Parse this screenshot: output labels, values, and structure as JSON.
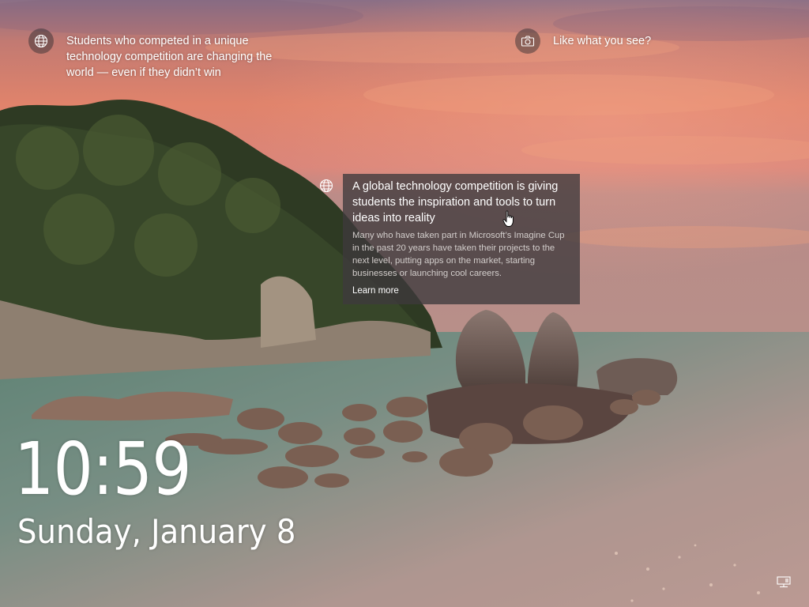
{
  "lockscreen": {
    "time": "10:59",
    "date": "Sunday, January 8"
  },
  "spotlight": {
    "headline": "Students who competed in a unique technology competition are changing the world — even if they didn’t win",
    "like_prompt": "Like what you see?"
  },
  "card": {
    "title": "A global technology competition is giving students the inspiration and tools to turn ideas into reality",
    "body": "Many who have taken part in Microsoft’s Imagine Cup in the past 20 years have taken their projects to the next level, putting apps on the market, starting businesses or launching cool careers.",
    "link": "Learn more"
  },
  "icons": {
    "headline_icon": "globe-icon",
    "like_icon": "camera-icon",
    "card_icon": "globe-icon",
    "status_icon": "network-icon"
  }
}
